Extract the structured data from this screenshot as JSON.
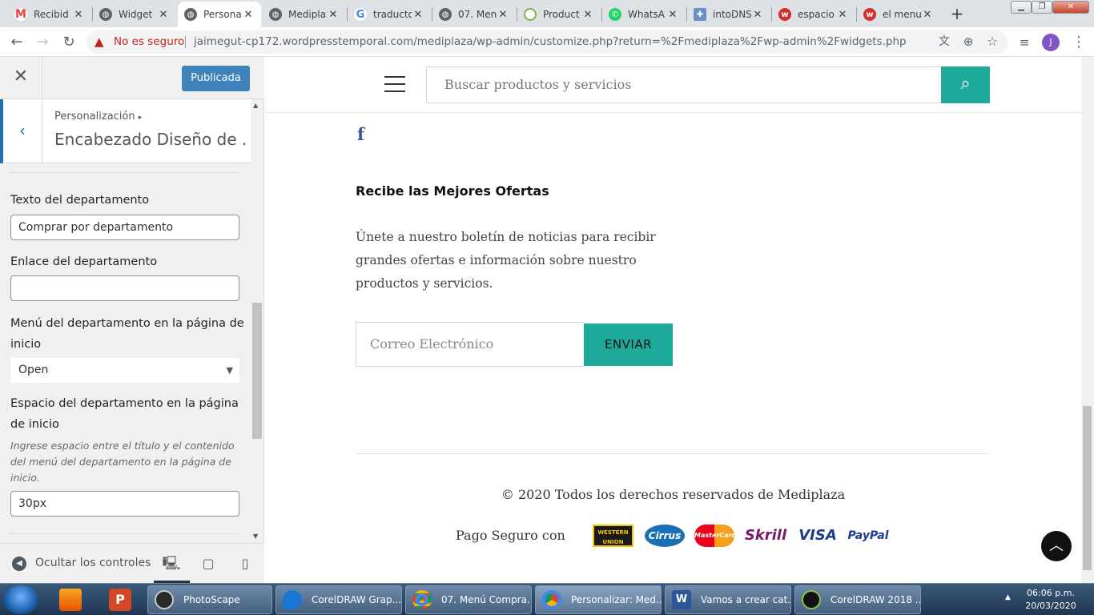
{
  "browser": {
    "tabs": [
      {
        "title": "Recibid",
        "icon_color": "#ea4335",
        "icon_char": "M"
      },
      {
        "title": "Widget",
        "icon_color": "#5f6368",
        "icon_char": ""
      },
      {
        "title": "Persona",
        "icon_color": "#5f6368",
        "icon_char": ""
      },
      {
        "title": "Mediplaz",
        "icon_color": "#5f6368",
        "icon_char": ""
      },
      {
        "title": "traducto",
        "icon_color": "#4285f4",
        "icon_char": "G"
      },
      {
        "title": "07. Men",
        "icon_color": "#5f6368",
        "icon_char": ""
      },
      {
        "title": "Product",
        "icon_color": "#7cb342",
        "icon_char": ""
      },
      {
        "title": "WhatsA",
        "icon_color": "#25d366",
        "icon_char": ""
      },
      {
        "title": "intoDNS",
        "icon_color": "#6a8fc7",
        "icon_char": ""
      },
      {
        "title": "espacio",
        "icon_color": "#d32f2f",
        "icon_char": "w"
      },
      {
        "title": "el menu",
        "icon_color": "#d32f2f",
        "icon_char": "w"
      }
    ],
    "active_tab": 2,
    "security_label": "No es seguro",
    "url": "jaimegut-cp172.wordpresstemporal.com/mediplaza/wp-admin/customize.php?return=%2Fmediplaza%2Fwp-admin%2Fwidgets.php",
    "profile_initial": "J"
  },
  "customizer": {
    "publish_label": "Publicada",
    "breadcrumb": "Personalización",
    "section_title": "Encabezado Diseño de ...",
    "fields": {
      "dept_text_label": "Texto del departamento",
      "dept_text_value": "Comprar por departamento",
      "dept_link_label": "Enlace del departamento",
      "dept_link_value": "",
      "dept_menu_label": "Menú del departamento en la página de inicio",
      "dept_menu_value": "Open",
      "dept_space_label": "Espacio del departamento en la página de inicio",
      "dept_space_desc": "Ingrese espacio entre el título y el contenido del menú del departamento en la página de inicio.",
      "dept_space_value": "30px"
    },
    "hide_controls_label": "Ocultar los controles"
  },
  "preview": {
    "search_placeholder": "Buscar productos y servicios",
    "newsletter_title": "Recibe las Mejores Ofertas",
    "newsletter_text": "Únete a nuestro boletín de noticias para recibir grandes ofertas e información sobre nuestro productos y servicios.",
    "email_placeholder": "Correo Electrónico",
    "submit_label": "ENVIAR",
    "copyright": "© 2020 Todos los derechos reservados de Mediplaza",
    "secure_payment_label": "Pago Seguro con",
    "payment_logos": [
      "WESTERN UNION",
      "Cirrus",
      "MasterCard",
      "Skrill",
      "VISA",
      "PayPal"
    ],
    "accent_color": "#1eaa9b"
  },
  "taskbar": {
    "items": [
      {
        "label": "PhotoScape"
      },
      {
        "label": "CorelDRAW Grap..."
      },
      {
        "label": "07. Menú Compra..."
      },
      {
        "label": "Personalizar: Med..."
      },
      {
        "label": "Vamos a crear cat..."
      },
      {
        "label": "CorelDRAW 2018 ..."
      }
    ],
    "time": "06:06 p.m.",
    "date": "20/03/2020"
  }
}
